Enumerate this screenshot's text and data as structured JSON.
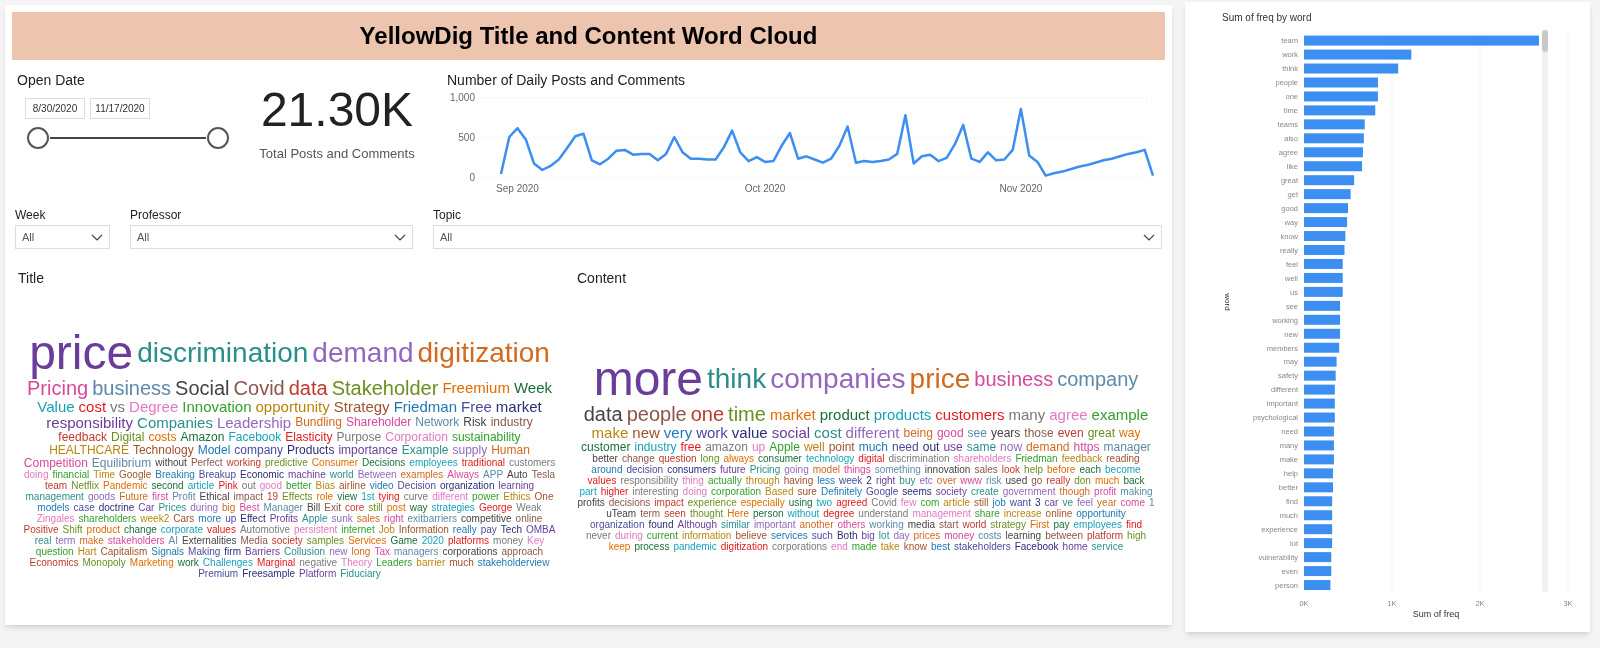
{
  "title": "YellowDig Title and Content Word Cloud",
  "date_slicer": {
    "label": "Open Date",
    "start": "8/30/2020",
    "end": "11/17/2020",
    "level": 1
  },
  "kpi": {
    "value": "21.30K",
    "label": "Total Posts and Comments"
  },
  "line_chart": {
    "chart_data": {
      "type": "line",
      "title": "Number of Daily Posts and Comments",
      "categories": [
        null,
        null,
        "Sep 2020",
        null,
        null,
        null,
        null,
        null,
        null,
        null,
        null,
        null,
        null,
        null,
        null,
        null,
        null,
        null,
        null,
        null,
        null,
        null,
        null,
        null,
        null,
        null,
        null,
        null,
        null,
        null,
        null,
        null,
        "Oct 2020",
        null,
        null,
        null,
        null,
        null,
        null,
        null,
        null,
        null,
        null,
        null,
        null,
        null,
        null,
        null,
        null,
        null,
        null,
        null,
        null,
        null,
        null,
        null,
        null,
        null,
        null,
        null,
        null,
        null,
        null,
        "Nov 2020",
        null,
        null,
        null,
        null,
        null,
        null,
        null,
        null,
        null,
        null,
        null,
        null,
        null,
        null,
        null,
        null
      ],
      "values": [
        50,
        510,
        620,
        480,
        180,
        100,
        150,
        230,
        370,
        520,
        550,
        220,
        170,
        240,
        340,
        350,
        290,
        300,
        300,
        220,
        300,
        510,
        320,
        240,
        240,
        230,
        230,
        380,
        590,
        320,
        210,
        260,
        200,
        210,
        400,
        560,
        240,
        270,
        230,
        190,
        240,
        400,
        640,
        190,
        210,
        200,
        210,
        230,
        300,
        780,
        180,
        270,
        290,
        210,
        250,
        420,
        660,
        240,
        200,
        320,
        220,
        230,
        350,
        860,
        280,
        200,
        30,
        60,
        80,
        110,
        140,
        160,
        190,
        220,
        240,
        270,
        300,
        320,
        350,
        30
      ],
      "yticks": [
        0,
        500,
        {
          "value": 1000,
          "label": "1,000"
        }
      ],
      "ylim": [
        0,
        1000
      ]
    }
  },
  "filters": [
    {
      "label": "Week",
      "value": "All"
    },
    {
      "label": "Professor",
      "value": "All"
    },
    {
      "label": "Topic",
      "value": "All"
    }
  ],
  "title_cloud": {
    "heading": "Title",
    "words": [
      "price",
      "discrimination",
      "demand",
      "digitization",
      "Pricing",
      "business",
      "Social",
      "Covid",
      "data",
      "Stakeholder",
      "Freemium",
      "Week",
      "Value",
      "cost",
      "vs",
      "Degree",
      "Innovation",
      "opportunity",
      "Strategy",
      "Friedman",
      "Free",
      "market",
      "responsibility",
      "Companies",
      "Leadership",
      "Bundling",
      "Shareholder",
      "Network",
      "Risk",
      "industry",
      "feedback",
      "Digital",
      "costs",
      "Amazon",
      "Facebook",
      "Elasticity",
      "Purpose",
      "Corporation",
      "sustainability",
      "HEALTHCARE",
      "Technology",
      "Model",
      "company",
      "Products",
      "importance",
      "Example",
      "supply",
      "Human",
      "Competition",
      "Equilibrium",
      "without",
      "Perfect",
      "working",
      "predictive",
      "Consumer",
      "Decisions",
      "employees",
      "traditional",
      "customers",
      "doing",
      "financial",
      "Time",
      "Google",
      "Breaking",
      "Breakup",
      "Economic",
      "machine",
      "world",
      "Between",
      "examples",
      "Always",
      "APP",
      "Auto",
      "Tesla",
      "team",
      "Netflix",
      "Pandemic",
      "second",
      "article",
      "Pink",
      "out",
      "good",
      "better",
      "Bias",
      "airline",
      "video",
      "Decision",
      "organization",
      "learning",
      "management",
      "goods",
      "Future",
      "first",
      "Profit",
      "Ethical",
      "impact",
      "19",
      "Effects",
      "role",
      "view",
      "1st",
      "tying",
      "curve",
      "different",
      "power",
      "Ethics",
      "One",
      "models",
      "case",
      "doctrine",
      "Car",
      "Prices",
      "during",
      "big",
      "Best",
      "Manager",
      "Bill",
      "Exit",
      "core",
      "still",
      "post",
      "way",
      "strategies",
      "George",
      "Weak",
      "Zingales",
      "shareholders",
      "week2",
      "Cars",
      "more",
      "up",
      "Effect",
      "Profits",
      "Apple",
      "sunk",
      "sales",
      "right",
      "exitbarriers",
      "competitive",
      "online",
      "Positive",
      "Shift",
      "product",
      "change",
      "corporate",
      "values",
      "Automotive",
      "persistent",
      "internet",
      "Job",
      "Information",
      "really",
      "pay",
      "Tech",
      "OMBA",
      "real",
      "term",
      "make",
      "stakeholders",
      "AI",
      "Externalities",
      "Media",
      "society",
      "samples",
      "Services",
      "Game",
      "2020",
      "platforms",
      "money",
      "Key",
      "question",
      "Hart",
      "Capitalism",
      "Signals",
      "Making",
      "firm",
      "Barriers",
      "Collusion",
      "new",
      "long",
      "Tax",
      "managers",
      "corporations",
      "approach",
      "Economics",
      "Monopoly",
      "Marketing",
      "work",
      "Challenges",
      "Marginal",
      "negative",
      "Theory",
      "Leaders",
      "barrier",
      "much",
      "stakeholderview",
      "Premium",
      "Freesample",
      "Platform",
      "Fiduciary"
    ]
  },
  "content_cloud": {
    "heading": "Content",
    "words": [
      "more",
      "think",
      "companies",
      "price",
      "business",
      "company",
      "data",
      "people",
      "one",
      "time",
      "market",
      "product",
      "products",
      "customers",
      "many",
      "agree",
      "example",
      "make",
      "new",
      "very",
      "work",
      "value",
      "social",
      "cost",
      "different",
      "being",
      "good",
      "see",
      "years",
      "those",
      "even",
      "great",
      "way",
      "customer",
      "industry",
      "free",
      "amazon",
      "up",
      "Apple",
      "well",
      "point",
      "much",
      "need",
      "out",
      "use",
      "same",
      "now",
      "demand",
      "https",
      "manager",
      "better",
      "change",
      "question",
      "long",
      "always",
      "consumer",
      "technology",
      "digital",
      "discrimination",
      "shareholders",
      "Friedman",
      "feedback",
      "reading",
      "around",
      "decision",
      "consumers",
      "future",
      "Pricing",
      "going",
      "model",
      "things",
      "something",
      "innovation",
      "sales",
      "look",
      "help",
      "before",
      "each",
      "become",
      "values",
      "responsibility",
      "thing",
      "actually",
      "through",
      "having",
      "less",
      "week",
      "2",
      "right",
      "buy",
      "etc",
      "over",
      "www",
      "risk",
      "used",
      "go",
      "really",
      "don",
      "much",
      "back",
      "part",
      "higher",
      "interesting",
      "doing",
      "corporation",
      "Based",
      "sure",
      "Definitely",
      "Google",
      "seems",
      "society",
      "create",
      "government",
      "though",
      "profit",
      "making",
      "profits",
      "decisions",
      "impact",
      "experience",
      "especially",
      "using",
      "two",
      "agreed",
      "Covid",
      "few",
      "com",
      "article",
      "still",
      "job",
      "want",
      "3",
      "car",
      "ve",
      "feel",
      "year",
      "come",
      "1",
      "uTeam",
      "term",
      "seen",
      "thought",
      "Here",
      "person",
      "without",
      "degree",
      "understand",
      "management",
      "share",
      "increase",
      "online",
      "opportunity",
      "organization",
      "found",
      "Although",
      "similar",
      "important",
      "another",
      "others",
      "working",
      "media",
      "start",
      "world",
      "strategy",
      "First",
      "pay",
      "employees",
      "find",
      "never",
      "during",
      "current",
      "information",
      "believe",
      "services",
      "such",
      "Both",
      "big",
      "lot",
      "day",
      "prices",
      "money",
      "costs",
      "learning",
      "between",
      "platform",
      "high",
      "keep",
      "process",
      "pandemic",
      "digitization",
      "corporations",
      "end",
      "made",
      "take",
      "know",
      "best",
      "stakeholders",
      "Facebook",
      "home",
      "service"
    ]
  },
  "bar_chart": {
    "chart_data": {
      "type": "bar",
      "orientation": "horizontal",
      "title": "Sum of freq by word",
      "xlabel": "Sum of freq",
      "ylabel": "word",
      "categories": [
        "team",
        "work",
        "think",
        "people",
        "one",
        "time",
        "teams",
        "also",
        "agree",
        "like",
        "great",
        "get",
        "good",
        "way",
        "know",
        "really",
        "feel",
        "well",
        "us",
        "see",
        "working",
        "new",
        "members",
        "may",
        "safety",
        "different",
        "important",
        "psychological",
        "need",
        "many",
        "make",
        "help",
        "better",
        "find",
        "much",
        "experience",
        "lot",
        "vulnerability",
        "even",
        "person"
      ],
      "values": [
        2670,
        1220,
        1070,
        840,
        840,
        810,
        690,
        680,
        670,
        660,
        570,
        530,
        500,
        490,
        470,
        460,
        440,
        440,
        440,
        410,
        410,
        410,
        400,
        370,
        360,
        350,
        350,
        350,
        340,
        340,
        340,
        330,
        330,
        320,
        320,
        320,
        320,
        310,
        310,
        300
      ],
      "xticks": [
        {
          "value": 0,
          "label": "0K"
        },
        {
          "value": 1000,
          "label": "1K"
        },
        {
          "value": 2000,
          "label": "2K"
        },
        {
          "value": 3000,
          "label": "3K"
        }
      ],
      "xlim": [
        0,
        3000
      ]
    }
  }
}
